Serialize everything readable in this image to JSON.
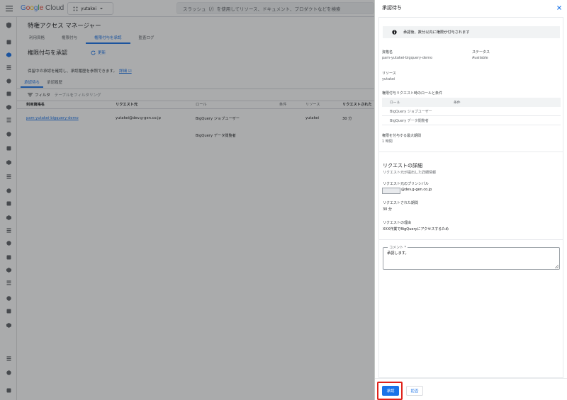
{
  "colors": {
    "brand": "#1a73e8",
    "highlight": "#e0221a",
    "overlay": "#202124"
  },
  "topbar": {
    "logo": {
      "g1": "G",
      "o1": "o",
      "o2": "o",
      "g2": "g",
      "l": "l",
      "e": "e",
      "cloud": " Cloud"
    },
    "project": "yutakei",
    "search_placeholder": "スラッシュ（/）を使用してリソース、ドキュメント、プロダクトなどを検索"
  },
  "rail_icons": [
    "iam-icon",
    "pin-icon",
    "shield-icon",
    "key-icon",
    "folder-icon",
    "account-icon",
    "wrench-icon",
    "report-icon",
    "list-icon",
    "chart-icon",
    "id-icon",
    "menu-icon",
    "tag-icon",
    "arrow-icon",
    "gear-icon",
    "security-icon",
    "report2-icon",
    "stack-icon",
    "book-icon",
    "support-icon",
    "lock-icon",
    "archive-icon",
    "grid-icon",
    "box-icon",
    "collapse-icon",
    "expand-icon"
  ],
  "main": {
    "page_title": "特権アクセス マネージャー",
    "tabs": [
      {
        "label": "利用資格"
      },
      {
        "label": "権限付与"
      },
      {
        "label": "権限付与を承認"
      },
      {
        "label": "監査ログ"
      }
    ],
    "sub_title": "権限付与を承認",
    "refresh_label": "更新",
    "hint_text": "保留中の承認を確認し、承認履歴を参照できます。",
    "hint_link": "詳細 ☑",
    "subtabs": [
      {
        "label": "承認待ち"
      },
      {
        "label": "承認履歴"
      }
    ],
    "filter_label": "フィルタ",
    "filter_placeholder": "テーブルをフィルタリング",
    "columns": [
      "利用資格名",
      "リクエスト元",
      "ロール",
      "条件",
      "リソース",
      "リクエストされた"
    ],
    "rows": [
      {
        "entitlement": "pam-yutakei-bigquery-demo",
        "requester": "yutakei@dev.g-gen.co.jp",
        "role1": "BigQuery ジョブユーザー",
        "role2": "BigQuery データ閲覧者",
        "resource": "yutakei",
        "duration": "30 分"
      }
    ]
  },
  "panel": {
    "title": "承認待ち",
    "banner": "承認後、数分以内に権限が付与されます",
    "entitlement_label": "資格名",
    "entitlement_value": "pam-yutakei-bigquery-demo",
    "status_label": "ステータス",
    "status_value": "Available",
    "resource_label": "リソース",
    "resource_value": "yutakei",
    "roles_label": "権限付与リクエスト時のロールと条件",
    "roles_header": {
      "role": "ロール",
      "condition": "条件"
    },
    "roles": [
      "BigQuery ジョブユーザー",
      "BigQuery データ閲覧者"
    ],
    "max_duration_label": "権限を付与する最大期間",
    "max_duration_value": "1 時間",
    "details_title": "リクエストの詳細",
    "details_sub": "リクエスト元が提出した詳細情報",
    "principal_label": "リクエスト元のプリンシパル",
    "principal_value": "@dev.g-gen.co.jp",
    "requested_duration_label": "リクエストされた期間",
    "requested_duration_value": "30 分",
    "reason_label": "リクエストの理由",
    "reason_value": "XXX作業でBigQueryにアクセスするため",
    "comment_label": "コメント *",
    "comment_value": "承認します。",
    "approve_label": "承認",
    "deny_label": "拒否"
  }
}
